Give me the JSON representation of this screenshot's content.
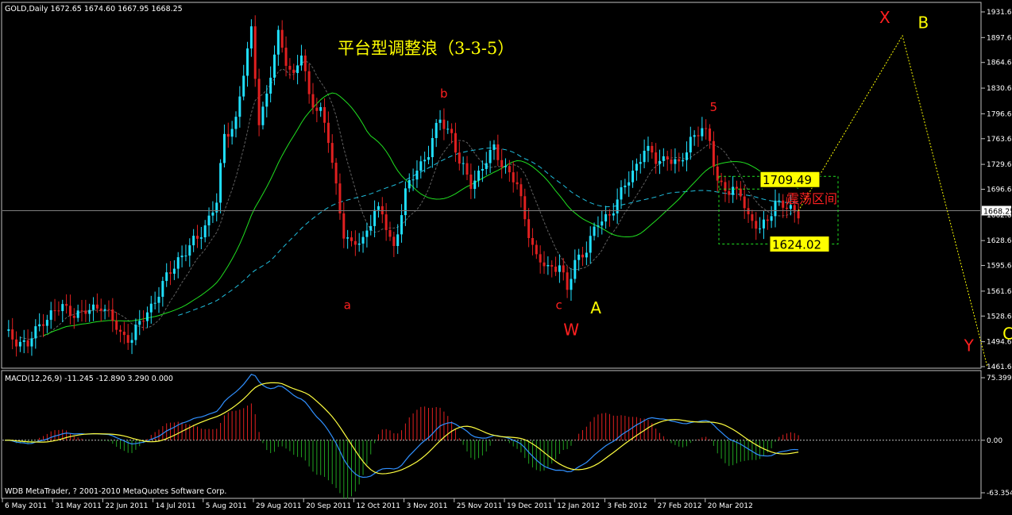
{
  "chart_data": [
    {
      "type": "candlestick",
      "header": "GOLD,Daily  1672.65 1674.60 1667.95 1668.25",
      "title": "平台型调整浪（3-3-5）",
      "y_ticks": [
        "1931.60",
        "1897.60",
        "1864.60",
        "1830.60",
        "1796.60",
        "1763.60",
        "1729.60",
        "1696.60",
        "1662.60",
        "1628.60",
        "1595.60",
        "1561.60",
        "1528.60",
        "1494.60",
        "1461.60"
      ],
      "ylim": [
        1461.6,
        1931.6
      ],
      "current_price_label": "1668.25",
      "current_price": 1668.25,
      "x_ticks": [
        "6 May 2011",
        "31 May 2011",
        "22 Jun 2011",
        "14 Jul 2011",
        "5 Aug 2011",
        "29 Aug 2011",
        "20 Sep 2011",
        "12 Oct 2011",
        "3 Nov 2011",
        "25 Nov 2011",
        "19 Dec 2011",
        "12 Jan 2012",
        "3 Feb 2012",
        "27 Feb 2012",
        "20 Mar 2012"
      ],
      "wave_labels": [
        {
          "text": "a",
          "color": "#ff2020",
          "price": 1538,
          "date_index": 88
        },
        {
          "text": "b",
          "color": "#ff2020",
          "price": 1818,
          "date_index": 113
        },
        {
          "text": "c",
          "color": "#ff2020",
          "price": 1538,
          "date_index": 143
        },
        {
          "text": "W",
          "color": "#ff2020",
          "price": 1503,
          "date_index": 145
        },
        {
          "text": "A",
          "color": "#ffff00",
          "price": 1532,
          "date_index": 152
        },
        {
          "text": "5",
          "color": "#ff2020",
          "price": 1800,
          "date_index": 183
        },
        {
          "text": "X",
          "color": "#ff2020",
          "price": 1917,
          "date_index": 227
        },
        {
          "text": "B",
          "color": "#ffff00",
          "price": 1910,
          "date_index": 237
        },
        {
          "text": "Y",
          "color": "#ff2020",
          "price": 1482,
          "date_index": 249
        },
        {
          "text": "C",
          "color": "#ffff00",
          "price": 1498,
          "date_index": 259
        }
      ],
      "levels": [
        {
          "label": "1709.49",
          "value": 1709.49
        },
        {
          "label": "1624.02",
          "value": 1624.02
        }
      ],
      "range_label": "震荡区间",
      "projection_path": [
        {
          "date_index": 206,
          "price": 1668
        },
        {
          "date_index": 233,
          "price": 1900
        },
        {
          "date_index": 255,
          "price": 1462
        }
      ],
      "projection_color": "#ffff00",
      "colors": {
        "up": "#20e0ff",
        "down": "#e02020",
        "ma_green": "#20e020",
        "ma_cyan": "#20c0e0",
        "ma_black_dash": "#808080"
      }
    },
    {
      "type": "macd",
      "label": "MACD(12,26,9) -11.245 -12.890 3.290 0.000",
      "y_ticks": [
        "75.399",
        "0.00",
        "-63.354"
      ],
      "ylim": [
        -63.354,
        75.399
      ],
      "colors": {
        "macd": "#3090ff",
        "signal": "#ffff40",
        "hist_pos": "#e02020",
        "hist_neg": "#20a020"
      }
    }
  ],
  "footer": "WDB MetaTrader, ? 2001-2010 MetaQuotes Software Corp."
}
